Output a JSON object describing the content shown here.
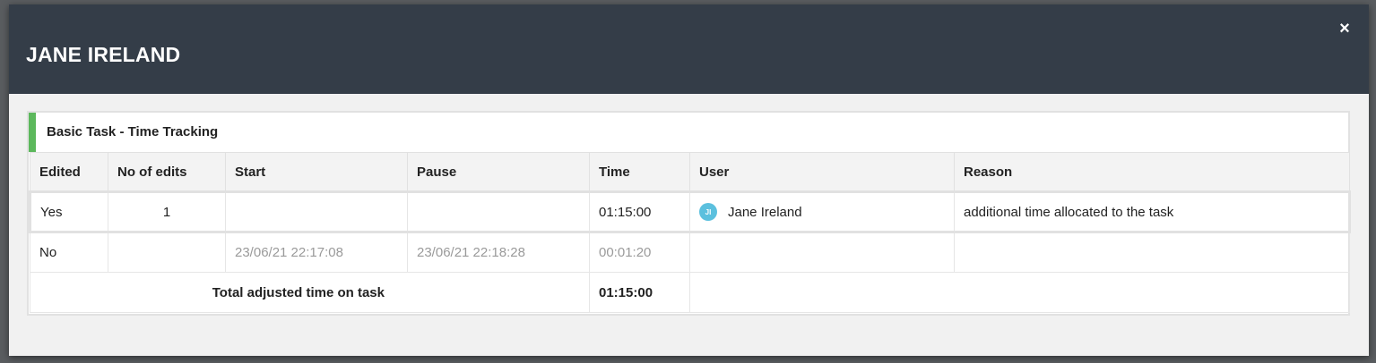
{
  "modal": {
    "title": "JANE IRELAND",
    "close_label": "×"
  },
  "panel": {
    "title": "Basic Task - Time Tracking",
    "accent_color": "#5cb85c"
  },
  "table": {
    "headers": [
      "Edited",
      "No of edits",
      "Start",
      "Pause",
      "Time",
      "User",
      "Reason"
    ],
    "rows": [
      {
        "edited": "Yes",
        "edits": "1",
        "start": "",
        "pause": "",
        "time": "01:15:00",
        "user_initials": "JI",
        "user_name": "Jane Ireland",
        "reason": "additional time allocated to the task"
      },
      {
        "edited": "No",
        "edits": "",
        "start": "23/06/21 22:17:08",
        "pause": "23/06/21 22:18:28",
        "time": "00:01:20",
        "user_initials": "",
        "user_name": "",
        "reason": ""
      }
    ],
    "total_label": "Total adjusted time on task",
    "total_time": "01:15:00"
  },
  "colors": {
    "header_bg": "#343d48",
    "avatar_bg": "#5bc0de"
  }
}
